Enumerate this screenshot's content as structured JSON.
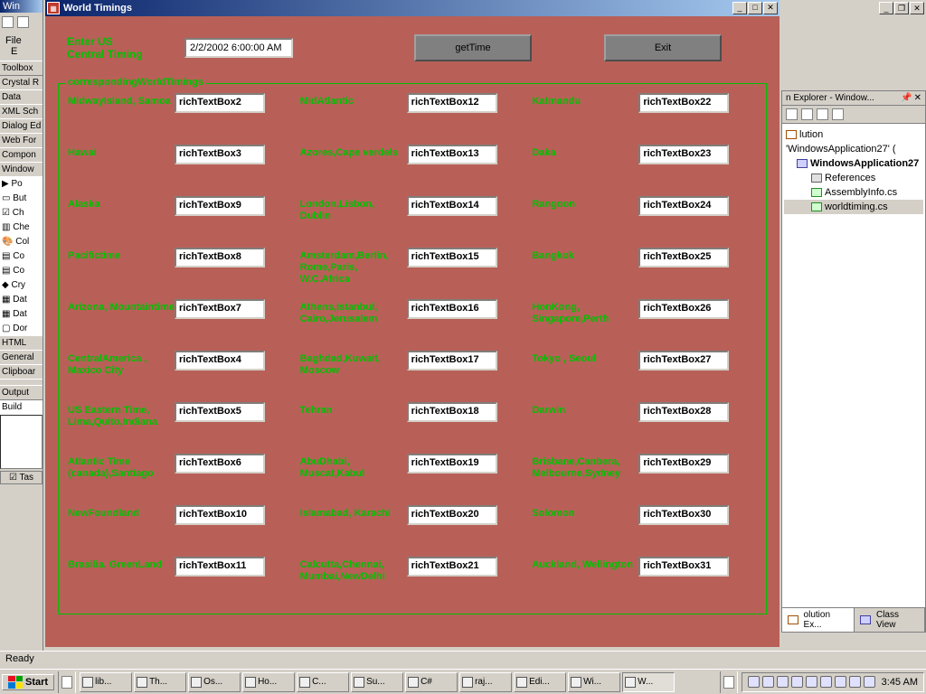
{
  "window": {
    "title": "World Timings"
  },
  "bg": {
    "leftTitle": "Win",
    "menuFile": "File",
    "menuE": "E",
    "toolbox": "Toolbox",
    "tabs": [
      "Crystal R",
      "Data",
      "XML Sch",
      "Dialog Ed",
      "Web For",
      "Compon",
      "Window"
    ],
    "ptrs": [
      "Po",
      "But",
      "Ch",
      "Che",
      "Col",
      "Co",
      "Co",
      "Cry",
      "Dat",
      "Dat",
      "Dor"
    ],
    "more": [
      "HTML",
      "General",
      "Clipboar"
    ],
    "output": "Output",
    "build": "Build",
    "taskl": "Tas",
    "ready": "Ready"
  },
  "solutionPanel": {
    "hdr": "n Explorer - Window...",
    "sln": "lution 'WindowsApplication27' (",
    "proj": "WindowsApplication27",
    "refs": "References",
    "asm": "AssemblyInfo.cs",
    "wt": "worldtiming.cs",
    "tabSol": "olution Ex...",
    "tabClass": "Class View"
  },
  "header": {
    "enterLabel": "Enter US\nCentral Timing",
    "inputValue": "2/2/2002 6:00:00 AM",
    "btnGet": "getTime",
    "btnExit": "Exit"
  },
  "groupTitle": "correspondingWorldTimings",
  "col1": [
    {
      "l": "MidwayIsland, Samoa",
      "v": "richTextBox2"
    },
    {
      "l": "Hawai",
      "v": "richTextBox3"
    },
    {
      "l": "Alaska",
      "v": "richTextBox9"
    },
    {
      "l": "Pacifictime",
      "v": "richTextBox8"
    },
    {
      "l": "Arizona, Mountaintime",
      "v": "richTextBox7"
    },
    {
      "l": "CentralAmerica , Maxico City",
      "v": "richTextBox4"
    },
    {
      "l": "US Eastern Time, Lima,Quito,Indiana",
      "v": "richTextBox5"
    },
    {
      "l": "Atlantic Time (canada),Santiago",
      "v": "richTextBox6"
    },
    {
      "l": "NewFoundland",
      "v": "richTextBox10"
    },
    {
      "l": "Brasilia, GreenLand",
      "v": "richTextBox11"
    }
  ],
  "col2": [
    {
      "l": "MidAtlantic",
      "v": "richTextBox12"
    },
    {
      "l": "Azores,Cape verdels",
      "v": "richTextBox13"
    },
    {
      "l": "London,Lisbon, Dublin",
      "v": "richTextBox14"
    },
    {
      "l": "Amsterdam,Berlin, Rome,Paris, W.C.Africa",
      "v": "richTextBox15"
    },
    {
      "l": "Athens,Istanbul, Cairo,Jerusalem",
      "v": "richTextBox16"
    },
    {
      "l": "Baghdad,Kuwait, Moscow",
      "v": "richTextBox17"
    },
    {
      "l": "Tehran",
      "v": "richTextBox18"
    },
    {
      "l": "AbuDhabi, Muscat,Kabul",
      "v": "richTextBox19"
    },
    {
      "l": "Islamabad, Karachi",
      "v": "richTextBox20"
    },
    {
      "l": "Calcutta,Chennai, Mumbai,NewDelhi",
      "v": "richTextBox21"
    }
  ],
  "col3": [
    {
      "l": "Katmandu",
      "v": "richTextBox22"
    },
    {
      "l": "Daka",
      "v": "richTextBox23"
    },
    {
      "l": "Rangoon",
      "v": "richTextBox24"
    },
    {
      "l": "Bangkok",
      "v": "richTextBox25"
    },
    {
      "l": "HonKong, Singapore,Perth",
      "v": "richTextBox26"
    },
    {
      "l": "Tokyo , Seoul",
      "v": "richTextBox27"
    },
    {
      "l": "Darwin",
      "v": "richTextBox28"
    },
    {
      "l": "Brisbane,Canbera, Melbourne,Sydney",
      "v": "richTextBox29"
    },
    {
      "l": "Solomon",
      "v": "richTextBox30"
    },
    {
      "l": "Auckland, Wellington",
      "v": "richTextBox31"
    }
  ],
  "taskbar": {
    "start": "Start",
    "items": [
      "lib...",
      "Th...",
      "Os...",
      "Ho...",
      "C...",
      "Su...",
      "C#",
      "raj...",
      "Edi...",
      "Wi...",
      "W..."
    ],
    "activeIndex": 10,
    "clock": "3:45 AM"
  }
}
